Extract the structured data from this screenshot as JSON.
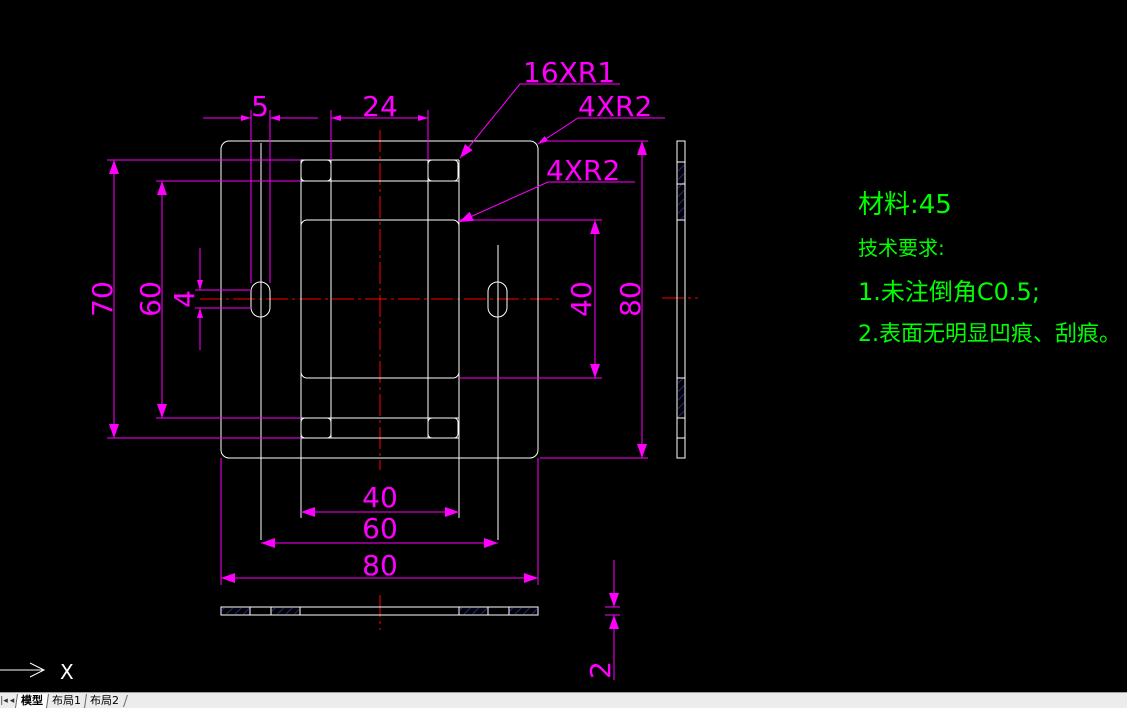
{
  "colors": {
    "background": "#000000",
    "geometry": "#ffffff",
    "dimension": "#ff00ff",
    "centerline": "#ff0000",
    "annotation": "#00ff00",
    "hatch": "#3030c0"
  },
  "drawing": {
    "dimensions": {
      "top_5": "5",
      "top_24": "24",
      "left_70": "70",
      "left_60": "60",
      "left_4": "4",
      "right_40": "40",
      "right_80": "80",
      "bottom_40": "40",
      "bottom_60": "60",
      "bottom_80": "80",
      "thickness_2": "2"
    },
    "leaders": {
      "r1": "16XR1",
      "r2_outer": "4XR2",
      "r2_inner": "4XR2"
    }
  },
  "notes": {
    "material": "材料:45",
    "requirements_title": "技术要求:",
    "item1": "1.未注倒角C0.5;",
    "item2": "2.表面无明显凹痕、刮痕。"
  },
  "ucs": {
    "x_label": "X"
  },
  "tabs": {
    "nav_icons": [
      "first-tab-icon",
      "prev-tab-icon"
    ],
    "items": [
      "模型",
      "布局1",
      "布局2"
    ],
    "active": "模型"
  }
}
